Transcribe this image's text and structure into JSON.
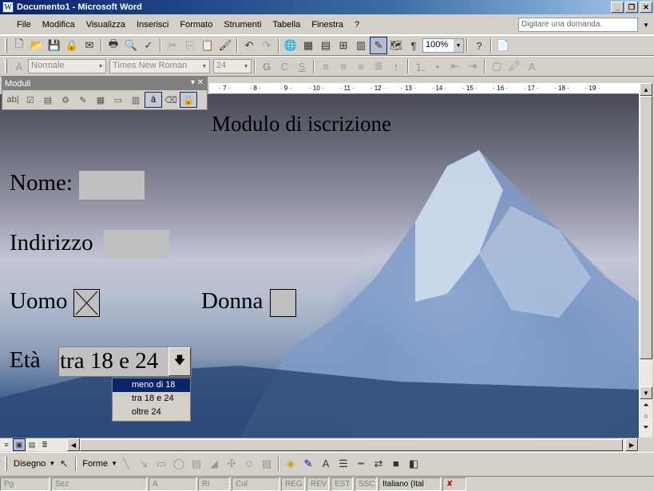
{
  "window": {
    "title": "Documento1 - Microsoft Word",
    "app_icon": "W"
  },
  "menu": [
    "File",
    "Modifica",
    "Visualizza",
    "Inserisci",
    "Formato",
    "Strumenti",
    "Tabella",
    "Finestra",
    "?"
  ],
  "ask_box": {
    "placeholder": "Digitare una domanda."
  },
  "toolbar_standard": {
    "zoom": "100%"
  },
  "toolbar_format": {
    "style": "Normale",
    "font": "Times New Roman",
    "size": "24",
    "bold": "G",
    "italic": "C",
    "underline": "S"
  },
  "moduli_toolbar": {
    "title": "Moduli",
    "text_field_icon": "ab|"
  },
  "ruler_ticks": [
    "7",
    "8",
    "9",
    "10",
    "11",
    "12",
    "13",
    "14",
    "15",
    "16",
    "17",
    "18",
    "19"
  ],
  "document": {
    "title": "Modulo di iscrizione",
    "label_nome": "Nome:",
    "label_indirizzo": "Indirizzo",
    "label_uomo": "Uomo",
    "label_donna": "Donna",
    "label_eta": "Età",
    "eta_value": "tra 18 e 24",
    "uomo_checked": true,
    "donna_checked": false,
    "eta_options": [
      "meno di 18",
      "tra 18 e 24",
      "oltre 24"
    ],
    "eta_selected_option": "meno di 18"
  },
  "drawing_toolbar": {
    "disegno": "Disegno",
    "forme": "Forme"
  },
  "status": {
    "pg": "Pg",
    "sez": "Sez",
    "a": "A",
    "ri": "Ri",
    "col": "Col",
    "reg": "REG",
    "rev": "REV",
    "est": "EST",
    "ssc": "SSC",
    "lang": "Italiano (Ital"
  },
  "colors": {
    "title_start": "#0a246a",
    "title_end": "#a6caf0",
    "selection": "#0a246a",
    "field_gray": "#c0c0c0"
  }
}
